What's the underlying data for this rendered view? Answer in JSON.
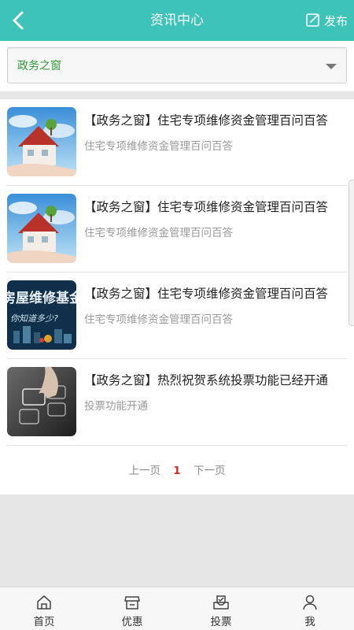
{
  "header": {
    "title": "资讯中心",
    "publish_label": "发布"
  },
  "filter": {
    "selected": "政务之窗"
  },
  "articles": [
    {
      "title": "【政务之窗】住宅专项维修资金管理百问百答",
      "summary": "住宅专项维修资金管理百问百答",
      "thumb": "house"
    },
    {
      "title": "【政务之窗】住宅专项维修资金管理百问百答",
      "summary": "住宅专项维修资金管理百问百答",
      "thumb": "house"
    },
    {
      "title": "【政务之窗】住宅专项维修资金管理百问百答",
      "summary": "住宅专项维修资金管理百问百答",
      "thumb": "fund-banner",
      "thumb_text": "房屋维修基金",
      "thumb_subtext": "你知道多少?"
    },
    {
      "title": "【政务之窗】热烈祝贺系统投票功能已经开通",
      "summary": "投票功能开通",
      "thumb": "touch-screen"
    }
  ],
  "pagination": {
    "prev": "上一页",
    "current": "1",
    "next": "下一页"
  },
  "tabs": [
    {
      "label": "首页",
      "icon": "home-icon"
    },
    {
      "label": "优惠",
      "icon": "shop-icon"
    },
    {
      "label": "投票",
      "icon": "ballot-icon"
    },
    {
      "label": "我",
      "icon": "user-icon"
    }
  ],
  "colors": {
    "header": "#3ec3b9",
    "filter_text": "#2f9a35",
    "current_page": "#d62b2b"
  }
}
